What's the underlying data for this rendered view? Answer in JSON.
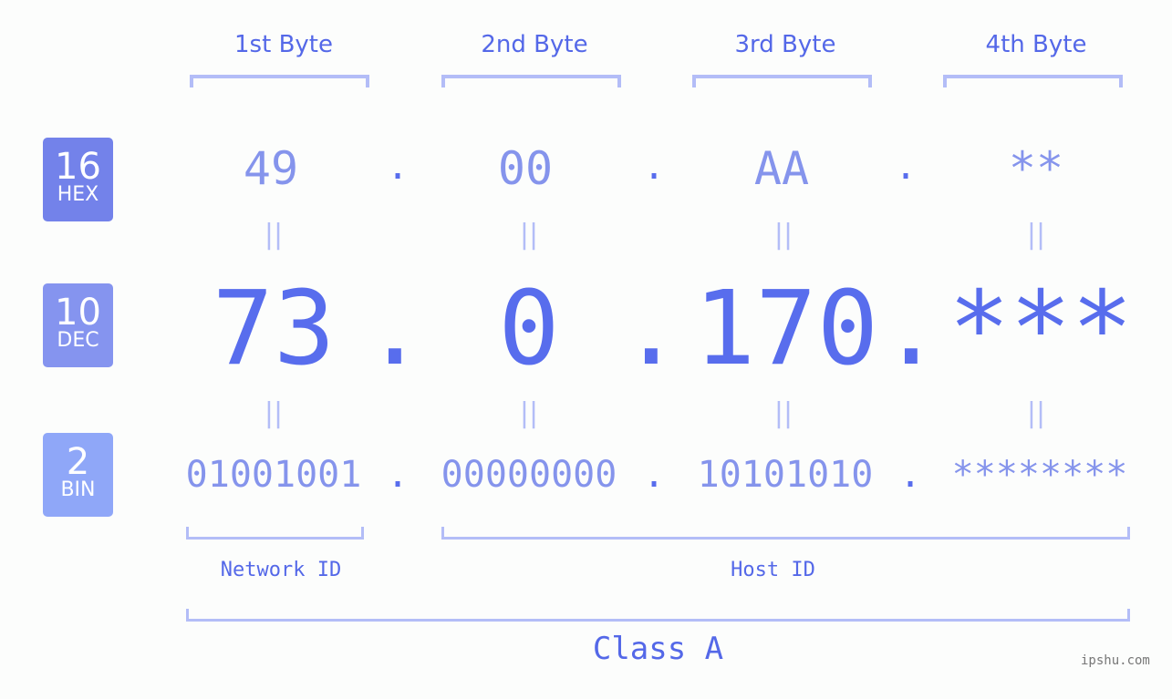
{
  "byte_headers": [
    "1st Byte",
    "2nd Byte",
    "3rd Byte",
    "4th Byte"
  ],
  "badges": {
    "hex": {
      "num": "16",
      "label": "HEX",
      "color": "#7382ea"
    },
    "dec": {
      "num": "10",
      "label": "DEC",
      "color": "#8594ef"
    },
    "bin": {
      "num": "2",
      "label": "BIN",
      "color": "#8fa7f8"
    }
  },
  "hex": [
    "49",
    "00",
    "AA",
    "**"
  ],
  "dec": [
    "73",
    "0",
    "170",
    "***"
  ],
  "bin": [
    "01001001",
    "00000000",
    "10101010",
    "********"
  ],
  "separator": ".",
  "equals": "||",
  "labels": {
    "network": "Network ID",
    "host": "Host ID",
    "class": "Class A"
  },
  "watermark": "ipshu.com"
}
